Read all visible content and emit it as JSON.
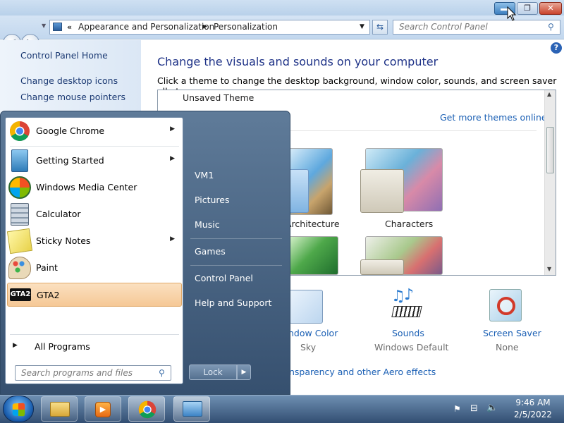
{
  "window": {
    "breadcrumb_root": "Appearance and Personalization",
    "breadcrumb_current": "Personalization",
    "search_placeholder": "Search Control Panel"
  },
  "leftpane": {
    "home": "Control Panel Home",
    "links": [
      "Change desktop icons",
      "Change mouse pointers"
    ]
  },
  "main": {
    "heading": "Change the visuals and sounds on your computer",
    "subheading": "Click a theme to change the desktop background, window color, sounds, and screen saver all at once.",
    "unsaved_theme": "Unsaved Theme",
    "get_more": "Get more themes online",
    "themes": [
      "Architecture",
      "Characters"
    ],
    "bottom": {
      "window_color_label": "ndow Color",
      "window_color_value": "Sky",
      "sounds_label": "Sounds",
      "sounds_value": "Windows Default",
      "screensaver_label": "Screen Saver",
      "screensaver_value": "None",
      "transparency_link": "nsparency and other Aero effects"
    }
  },
  "startmenu": {
    "programs": [
      {
        "label": "Google Chrome",
        "has_submenu": true
      },
      {
        "label": "Getting Started",
        "has_submenu": true
      },
      {
        "label": "Windows Media Center",
        "has_submenu": false
      },
      {
        "label": "Calculator",
        "has_submenu": false
      },
      {
        "label": "Sticky Notes",
        "has_submenu": true
      },
      {
        "label": "Paint",
        "has_submenu": false
      },
      {
        "label": "GTA2",
        "has_submenu": false,
        "highlighted": true
      }
    ],
    "all_programs": "All Programs",
    "search_placeholder": "Search programs and files",
    "right_links": [
      "VM1",
      "Pictures",
      "Music",
      "Games",
      "Control Panel",
      "Help and Support"
    ],
    "lock_label": "Lock"
  },
  "taskbar": {
    "items": [
      "explorer-icon",
      "media-player-icon",
      "chrome-icon",
      "control-panel-icon"
    ],
    "time": "9:46 AM",
    "date": "2/5/2022"
  },
  "colors": {
    "accent_blue": "#1e3287",
    "link_blue": "#1a5fb4",
    "highlight_orange": "#f5c896"
  }
}
